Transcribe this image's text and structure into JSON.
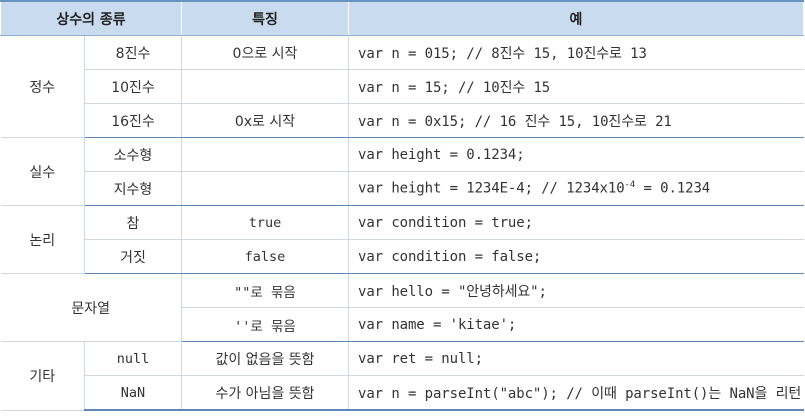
{
  "header": {
    "col1": "상수의 종류",
    "col2": "특징",
    "col3": "예"
  },
  "groups": {
    "integer": {
      "label": "정수",
      "rows": [
        {
          "sub": "8진수",
          "feature": "0으로 시작",
          "example": "var n = 015;    // 8진수 15, 10진수로 13"
        },
        {
          "sub": "10진수",
          "feature": "",
          "example": "var n = 15;     // 10진수 15"
        },
        {
          "sub": "16진수",
          "feature": "0x로 시작",
          "example": "var n = 0x15;  // 16 진수 15, 10진수로 21"
        }
      ]
    },
    "real": {
      "label": "실수",
      "rows": [
        {
          "sub": "소수형",
          "feature": "",
          "example": "var height = 0.1234;"
        },
        {
          "sub": "지수형",
          "feature": "",
          "example_main": "var height = 1234E-4; // 1234x10",
          "example_sup": "-4",
          "example_tail": " = 0.1234"
        }
      ]
    },
    "boolean": {
      "label": "논리",
      "rows": [
        {
          "sub": "참",
          "feature": "true",
          "example": "var condition = true;"
        },
        {
          "sub": "거짓",
          "feature": "false",
          "example": "var condition = false;"
        }
      ]
    },
    "string": {
      "label": "문자열",
      "rows": [
        {
          "feature": "\"\"로 묶음",
          "example": "var hello = \"안녕하세요\";"
        },
        {
          "feature": "''로 묶음",
          "example": "var name = 'kitae';"
        }
      ]
    },
    "etc": {
      "label": "기타",
      "rows": [
        {
          "sub": "null",
          "feature": "값이 없음을 뜻함",
          "example": "var ret = null;"
        },
        {
          "sub": "NaN",
          "feature": "수가 아님을 뜻함",
          "example": "var n = parseInt(\"abc\");  // 이때 parseInt()는 NaN을 리턴"
        }
      ]
    }
  }
}
